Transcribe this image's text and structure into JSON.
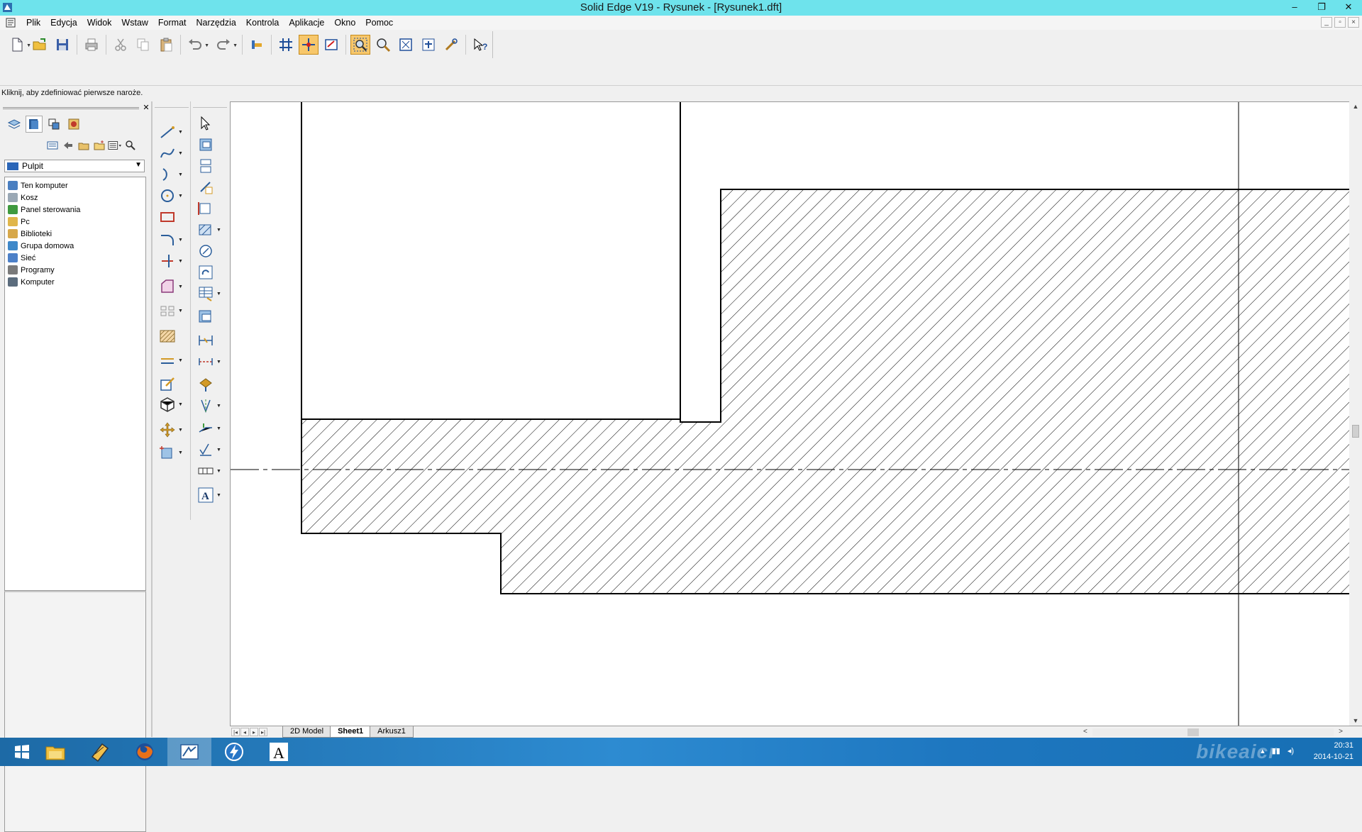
{
  "window": {
    "title": "Solid Edge V19 - Rysunek - [Rysunek1.dft]",
    "controls": [
      "–",
      "❐",
      "✕"
    ]
  },
  "menu": [
    "Plik",
    "Edycja",
    "Widok",
    "Wstaw",
    "Format",
    "Narzędzia",
    "Kontrola",
    "Aplikacje",
    "Okno",
    "Pomoc"
  ],
  "prompt": "Kliknij, aby zdefiniować pierwsze naroże.",
  "library": {
    "path": "Pulpit",
    "tree": [
      {
        "label": "Ten komputer",
        "icon": "computer-icon",
        "color": "#4a7fc1"
      },
      {
        "label": "Kosz",
        "icon": "recycle-bin-icon",
        "color": "#9aa8b5"
      },
      {
        "label": "Panel sterowania",
        "icon": "control-panel-icon",
        "color": "#3f9a3f"
      },
      {
        "label": "Pc",
        "icon": "user-folder-icon",
        "color": "#e0b64a"
      },
      {
        "label": "Biblioteki",
        "icon": "libraries-icon",
        "color": "#d7a84a"
      },
      {
        "label": "Grupa domowa",
        "icon": "homegroup-icon",
        "color": "#3e88c9"
      },
      {
        "label": "Sieć",
        "icon": "network-icon",
        "color": "#4c80c8"
      },
      {
        "label": "Programy",
        "icon": "programs-icon",
        "color": "#7a7a7a"
      },
      {
        "label": "Komputer",
        "icon": "computer-icon",
        "color": "#5b6c7d"
      }
    ]
  },
  "sheets": {
    "tabs": [
      "2D Model",
      "Sheet1",
      "Arkusz1"
    ],
    "active": "Sheet1"
  },
  "taskbar": {
    "items": [
      "start-icon",
      "file-explorer-icon",
      "sketch-app-icon",
      "firefox-icon",
      "solid-edge-icon",
      "flash-icon",
      "fonts-icon"
    ],
    "watermark": "bikeaicr",
    "time": "20:31",
    "date": "2014-10-21"
  }
}
